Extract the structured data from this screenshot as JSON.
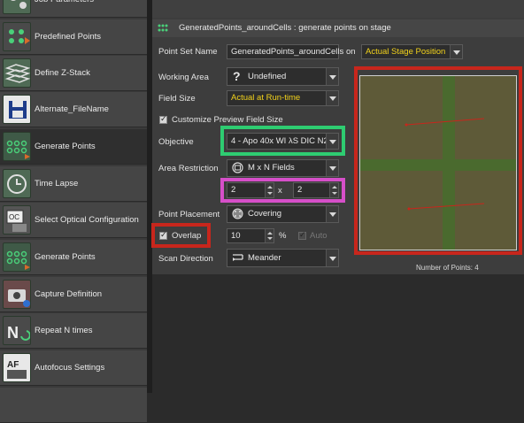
{
  "sidebar": {
    "items": [
      {
        "label": "Job Parameters",
        "icon": "job-parameters-icon"
      },
      {
        "label": "Predefined Points",
        "icon": "predefined-points-icon"
      },
      {
        "label": "Define Z-Stack",
        "icon": "z-stack-icon"
      },
      {
        "label": "Alternate_FileName",
        "icon": "save-file-icon"
      },
      {
        "label": "Generate Points",
        "icon": "generate-points-icon"
      },
      {
        "label": "Time Lapse",
        "icon": "time-lapse-icon"
      },
      {
        "label": "Select Optical Configuration",
        "icon": "optical-configuration-icon"
      },
      {
        "label": "Generate Points",
        "icon": "generate-points-icon"
      },
      {
        "label": "Capture Definition",
        "icon": "capture-camera-icon"
      },
      {
        "label": "Repeat N times",
        "icon": "repeat-n-icon"
      },
      {
        "label": "Autofocus Settings",
        "icon": "autofocus-icon"
      }
    ],
    "active_index": 4,
    "icon_texts": {
      "repeat": "N",
      "autofocus": "AF",
      "optical": "OC"
    }
  },
  "panel": {
    "title": "GeneratedPoints_aroundCells : generate points on stage",
    "point_set_name_label": "Point Set Name",
    "point_set_name_value": "GeneratedPoints_aroundCells",
    "on_label": "on",
    "stage_position_value": "Actual Stage Position",
    "working_area_label": "Working Area",
    "working_area_value": "Undefined",
    "working_area_glyph": "?",
    "field_size_label": "Field Size",
    "field_size_value": "Actual at Run-time",
    "customize_preview_label": "Customize Preview Field Size",
    "objective_label": "Objective",
    "objective_value": "4 - Apo 40x WI λS DIC N2",
    "area_restriction_label": "Area Restriction",
    "area_restriction_value": "M x N Fields",
    "m_value": "2",
    "x_label": "x",
    "n_value": "2",
    "point_placement_label": "Point Placement",
    "point_placement_value": "Covering",
    "overlap_label": "Overlap",
    "overlap_value": "10",
    "percent_label": "%",
    "auto_label": "Auto",
    "scan_direction_label": "Scan Direction",
    "scan_direction_value": "Meander",
    "number_of_points_label": "Number of Points: 4"
  },
  "colors": {
    "highlight_red": "#c8261c",
    "highlight_green": "#2ecc71",
    "highlight_magenta": "#d64fc9",
    "yellow_text": "#f2d21b",
    "preview_field": "#5e5a38",
    "preview_band": "#4a6a2e"
  }
}
